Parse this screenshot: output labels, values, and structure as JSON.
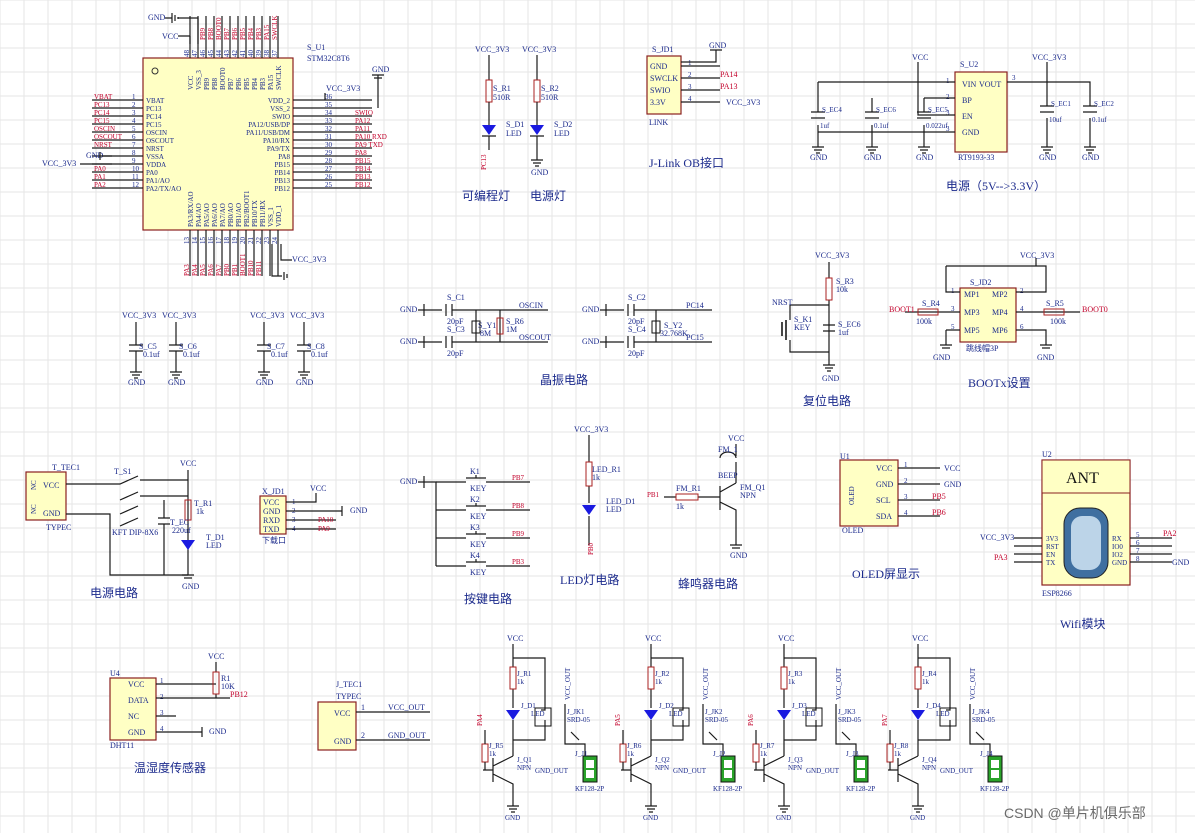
{
  "mcu": {
    "ref": "S_U1",
    "part": "STM32C8T6",
    "left_pins": [
      {
        "net": "VBAT",
        "name": "VBAT",
        "num": "1"
      },
      {
        "net": "PC13",
        "name": "PC13",
        "num": "2"
      },
      {
        "net": "PC14",
        "name": "PC14",
        "num": "3"
      },
      {
        "net": "PC15",
        "name": "PC15",
        "num": "4"
      },
      {
        "net": "OSCIN",
        "name": "OSCIN",
        "num": "5"
      },
      {
        "net": "OSCOUT",
        "name": "OSCOUT",
        "num": "6"
      },
      {
        "net": "NRST",
        "name": "NRST",
        "num": "7"
      },
      {
        "net": "GND",
        "name": "VSSA",
        "num": "8"
      },
      {
        "net": "VCC_3V3",
        "name": "VDDA",
        "num": "9"
      },
      {
        "net": "PA0",
        "name": "PA0",
        "num": "10"
      },
      {
        "net": "PA1",
        "name": "PA1/AO",
        "num": "11"
      },
      {
        "net": "PA2",
        "name": "PA2/TX/AO",
        "num": "12"
      }
    ],
    "right_pins": [
      {
        "net": "VCC_3V3",
        "name": "VDD_2",
        "num": "36"
      },
      {
        "net": "",
        "name": "VSS_2",
        "num": "35"
      },
      {
        "net": "SWIO",
        "name": "SWIO",
        "num": "34"
      },
      {
        "net": "PA12",
        "name": "PA12/USB/DP",
        "num": "33"
      },
      {
        "net": "PA11",
        "name": "PA11/USB/DM",
        "num": "32"
      },
      {
        "net": "PA10 RXD",
        "name": "PA10/RX",
        "num": "31"
      },
      {
        "net": "PA9 TXD",
        "name": "PA9/TX",
        "num": "30"
      },
      {
        "net": "PA8",
        "name": "PA8",
        "num": "29"
      },
      {
        "net": "PB15",
        "name": "PB15",
        "num": "28"
      },
      {
        "net": "PB14",
        "name": "PB14",
        "num": "27"
      },
      {
        "net": "PB13",
        "name": "PB13",
        "num": "26"
      },
      {
        "net": "PB12",
        "name": "PB12",
        "num": "25"
      }
    ],
    "top_pins": [
      "VCC",
      "VSS_3",
      "PB9",
      "PB8",
      "BOOT0",
      "PB7",
      "PB6",
      "PB5",
      "PB4",
      "PB3",
      "PA15",
      "SWCLK"
    ],
    "top_nums": [
      "48",
      "47",
      "46",
      "45",
      "44",
      "43",
      "42",
      "41",
      "40",
      "39",
      "38",
      "37"
    ],
    "top_nets": [
      "VCC",
      "GND",
      "PB9",
      "PB8",
      "BOOT0",
      "PB7",
      "PB6",
      "PB5",
      "PB4",
      "PB3",
      "PA15",
      "SWCLK"
    ],
    "bottom_pins": [
      "PA3/RX/AO",
      "PA4/AO",
      "PA5/AO",
      "PA6/AO",
      "PA7/AO",
      "PB0/AO",
      "PB1/AO",
      "PB2/BOOT1",
      "PB10/TX",
      "PB11/RX",
      "VSS_1",
      "VDD_1"
    ],
    "bottom_nums": [
      "13",
      "14",
      "15",
      "16",
      "17",
      "18",
      "19",
      "20",
      "21",
      "22",
      "23",
      "24"
    ],
    "bottom_nets": [
      "PA3",
      "PA4",
      "PA5",
      "PA6",
      "PA7",
      "PB0",
      "PB1",
      "BOOT1",
      "PB10",
      "PB11",
      "",
      ""
    ],
    "gnd": "GND",
    "vcc": "VCC",
    "vcc_3v3": "VCC_3V3"
  },
  "decoupling": [
    {
      "ref": "S_C5",
      "value": "0.1uf"
    },
    {
      "ref": "S_C6",
      "value": "0.1uf"
    },
    {
      "ref": "S_C7",
      "value": "0.1uf"
    },
    {
      "ref": "S_C8",
      "value": "0.1uf"
    }
  ],
  "leds_top": {
    "title_prog": "可编程灯",
    "title_power": "电源灯",
    "r1": {
      "ref": "S_R1",
      "value": "510R"
    },
    "r2": {
      "ref": "S_R2",
      "value": "510R"
    },
    "d1": {
      "ref": "S_D1",
      "value": "LED"
    },
    "d2": {
      "ref": "S_D2",
      "value": "LED"
    },
    "net_pc13": "PC13"
  },
  "jlink": {
    "ref": "S_JD1",
    "pins": [
      "GND",
      "SWCLK",
      "SWIO",
      "3.3V"
    ],
    "nets": [
      "",
      "PA14",
      "PA13",
      "VCC_3V3"
    ],
    "sub": "LINK",
    "title": "J-Link OB接口"
  },
  "regulator": {
    "ref": "S_U2",
    "part": "RT9193-33",
    "pins": [
      {
        "name": "VIN",
        "num": "1"
      },
      {
        "name": "BP",
        "num": "2"
      },
      {
        "name": "EN",
        "num": "3"
      },
      {
        "name": "GND",
        "num": "3"
      }
    ],
    "out_name": "VOUT",
    "out_num": "3",
    "caps": [
      {
        "ref": "S_EC4",
        "value": "1uf"
      },
      {
        "ref": "S_EC6",
        "value": "0.1uf"
      },
      {
        "ref": "S_EC5",
        "value": "0.022uf"
      },
      {
        "ref": "S_EC1",
        "value": "10uf"
      },
      {
        "ref": "S_EC2",
        "value": "0.1uf"
      }
    ],
    "title": "电源（5V-->3.3V）"
  },
  "crystal": {
    "c1": {
      "ref": "S_C1",
      "value": "20pF"
    },
    "c3": {
      "ref": "S_C3",
      "value": "20pF"
    },
    "y1": {
      "ref": "S_Y1",
      "value": "8M"
    },
    "r6": {
      "ref": "S_R6",
      "value": "1M"
    },
    "c2": {
      "ref": "S_C2",
      "value": "20pF"
    },
    "c4": {
      "ref": "S_C4",
      "value": "20pF"
    },
    "y2": {
      "ref": "S_Y2",
      "value": "32.768K"
    },
    "nets": [
      "OSCIN",
      "OSCOUT",
      "PC14",
      "PC15"
    ],
    "title": "晶振电路"
  },
  "reset": {
    "r3": {
      "ref": "S_R3",
      "value": "10k"
    },
    "k1": {
      "ref": "S_K1",
      "value": "KEY"
    },
    "ec6": {
      "ref": "S_EC6",
      "value": "1uf"
    },
    "net": "NRST",
    "title": "复位电路"
  },
  "boot": {
    "ref": "S_JD2",
    "pins": [
      "MP1",
      "MP2",
      "MP3",
      "MP4",
      "MP5",
      "MP6"
    ],
    "nums": [
      "1",
      "2",
      "3",
      "4",
      "5",
      "6"
    ],
    "r4": {
      "ref": "S_R4",
      "value": "100k"
    },
    "r5": {
      "ref": "S_R5",
      "value": "100k"
    },
    "net_l": "BOOT1",
    "net_r": "BOOT0",
    "sub": "跳线帽3P",
    "title": "BOOTx设置"
  },
  "power_in": {
    "ref": "T_TEC1",
    "sub": "TYPEC",
    "pins": [
      "NC",
      "VCC",
      "NC",
      "GND"
    ],
    "switch": {
      "ref": "T_S1",
      "value": "KFT DIP-8X6"
    },
    "r1": {
      "ref": "T_R1",
      "value": "1k"
    },
    "ec": {
      "ref": "T_EC",
      "value": "220uf"
    },
    "d1": {
      "ref": "T_D1",
      "value": "LED"
    },
    "title": "电源电路"
  },
  "uart": {
    "ref": "X_JD1",
    "pins": [
      "VCC",
      "GND",
      "RXD",
      "TXD"
    ],
    "nets": [
      "",
      "",
      "PA10",
      "PA9"
    ],
    "sub": "下载口"
  },
  "keys": {
    "items": [
      {
        "ref": "K1",
        "value": "KEY",
        "net": "PB7"
      },
      {
        "ref": "K2",
        "value": "KEY",
        "net": "PB8"
      },
      {
        "ref": "K3",
        "value": "KEY",
        "net": "PB9"
      },
      {
        "ref": "K4",
        "value": "KEY",
        "net": "PB3"
      }
    ],
    "title": "按键电路"
  },
  "led_circuit": {
    "r1": {
      "ref": "LED_R1",
      "value": "1k"
    },
    "d1": {
      "ref": "LED_D1",
      "value": "LED"
    },
    "net": "PB0",
    "title": "LED灯电路"
  },
  "buzzer": {
    "ref": "FM_1",
    "sub": "BEEP",
    "r1": {
      "ref": "FM_R1",
      "value": "1k"
    },
    "q1": {
      "ref": "FM_Q1",
      "value": "NPN"
    },
    "net": "PB1",
    "title": "蜂鸣器电路"
  },
  "oled": {
    "ref": "U1",
    "pins": [
      "VCC",
      "GND",
      "SCL",
      "SDA"
    ],
    "nums": [
      "1",
      "2",
      "3",
      "4"
    ],
    "nets": [
      "VCC",
      "GND",
      "PB5",
      "PB6"
    ],
    "side": "OLED",
    "sub": "OLED",
    "title": "OLED屏显示"
  },
  "wifi": {
    "ref": "U2",
    "ant": "ANT",
    "left": [
      "3V3",
      "RST",
      "EN",
      "TX"
    ],
    "right": [
      "RX",
      "IO0",
      "IO2",
      "GND"
    ],
    "nums_r": [
      "5",
      "6",
      "7",
      "8"
    ],
    "net_l": "PA3",
    "net_r": "PA2",
    "sub": "ESP8266",
    "title": "Wifi模块"
  },
  "dht": {
    "ref": "U4",
    "pins": [
      "VCC",
      "DATA",
      "NC",
      "GND"
    ],
    "nums": [
      "1",
      "2",
      "3",
      "4"
    ],
    "r1": {
      "ref": "R1",
      "value": "10K"
    },
    "net": "PB12",
    "sub": "DHT11",
    "title": "温湿度传感器"
  },
  "typec_out": {
    "ref": "J_TEC1",
    "sub": "TYPEC",
    "nets": [
      "VCC_OUT",
      "GND_OUT"
    ],
    "nums": [
      "1",
      "2"
    ]
  },
  "relays": [
    {
      "r": "J_R1",
      "d": "J_D1",
      "q": "J_Q1",
      "rb": "J_R5",
      "k": "J_JK1",
      "j": "J_J1",
      "ctrl": "PA4"
    },
    {
      "r": "J_R2",
      "d": "J_D2",
      "q": "J_Q2",
      "rb": "J_R6",
      "k": "J_JK2",
      "j": "J_J2",
      "ctrl": "PA5"
    },
    {
      "r": "J_R3",
      "d": "J_D3",
      "q": "J_Q3",
      "rb": "J_R7",
      "k": "J_JK3",
      "j": "J_J3",
      "ctrl": "PA6"
    },
    {
      "r": "J_R4",
      "d": "J_D4",
      "q": "J_Q4",
      "rb": "J_R8",
      "k": "J_JK4",
      "j": "J_J4",
      "ctrl": "PA7"
    }
  ],
  "relay_common": {
    "rval": "1k",
    "dval": "LED",
    "qval": "NPN",
    "kval": "SRD-05",
    "jval": "KF128-2P",
    "vcc_out": "VCC_OUT",
    "gnd_out": "GND_OUT"
  },
  "watermark": "CSDN @单片机俱乐部"
}
